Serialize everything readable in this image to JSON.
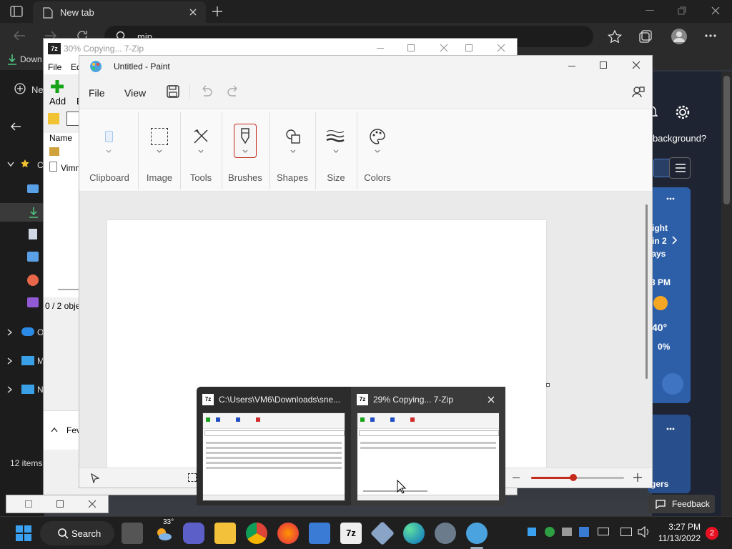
{
  "browser": {
    "tab_title": "New tab",
    "address_text": "mip",
    "downloads_label": "Down",
    "new_label": "Ne",
    "background_prompt": "background?",
    "weather_line1": "ight",
    "weather_line2": "in 2",
    "weather_line3": "lays",
    "weather_time": "3 PM",
    "weather_temp": "40°",
    "weather_precip": "0%",
    "gers_label": "gers",
    "feedback_label": "Feedback"
  },
  "explorer": {
    "items_count": "12 items",
    "fev_label": "Fev",
    "c_label": "C",
    "o_label": "O",
    "m_label": "M",
    "n_label": "N"
  },
  "sevenzip_back": {
    "title": "30% Copying... 7-Zip",
    "menu_file": "File",
    "menu_edit": "Ed",
    "add_label": "Add",
    "add_extra": "E",
    "col_name": "Name",
    "file_item": "Vimn",
    "status": "0 / 2 obje"
  },
  "paint": {
    "title": "Untitled - Paint",
    "menu": [
      "File",
      "View"
    ],
    "groups": [
      {
        "label": "Clipboard"
      },
      {
        "label": "Image"
      },
      {
        "label": "Tools"
      },
      {
        "label": "Brushes"
      },
      {
        "label": "Shapes"
      },
      {
        "label": "Size"
      },
      {
        "label": "Colors"
      }
    ],
    "zoom_level": 0.45
  },
  "thumbnails": [
    {
      "title": "C:\\Users\\VM6\\Downloads\\sne...",
      "app": "7z"
    },
    {
      "title": "29% Copying... 7-Zip",
      "app": "7z"
    }
  ],
  "taskbar": {
    "search_label": "Search",
    "weather_temp": "33°",
    "sevenzip_label": "7z",
    "time": "3:27 PM",
    "date": "11/13/2022",
    "notification_count": "2"
  },
  "colors": {
    "accent_red": "#c42b1c",
    "taskbar": "#1f1f1f",
    "browser_dark": "#202020"
  }
}
